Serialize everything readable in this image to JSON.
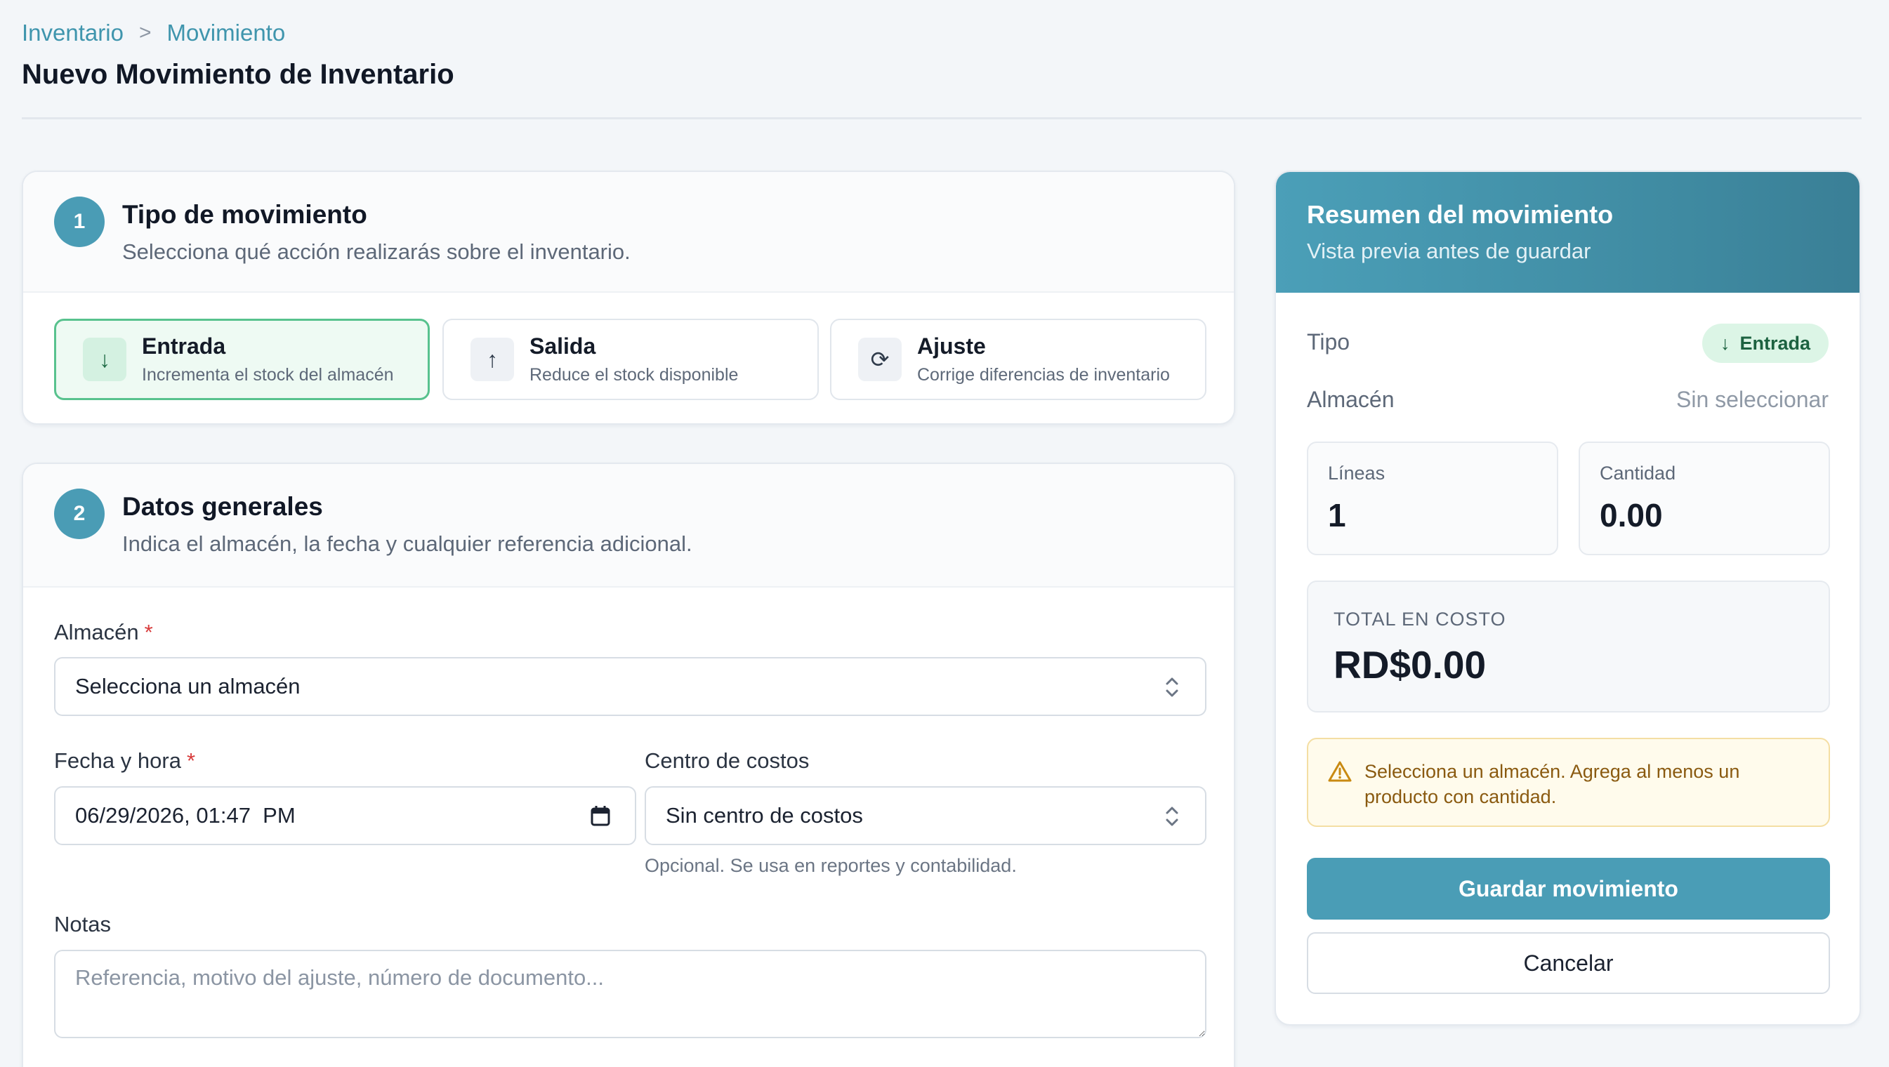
{
  "breadcrumb": {
    "items": [
      "Inventario",
      "Movimiento"
    ],
    "separator": ">"
  },
  "page": {
    "title": "Nuevo Movimiento de Inventario"
  },
  "section1": {
    "step": "1",
    "title": "Tipo de movimiento",
    "subtitle": "Selecciona qué acción realizarás sobre el inventario.",
    "options": [
      {
        "name": "Entrada",
        "description": "Incrementa el stock del almacén",
        "icon": "arrow-down-icon",
        "glyph": "↓",
        "selected": true
      },
      {
        "name": "Salida",
        "description": "Reduce el stock disponible",
        "icon": "arrow-up-icon",
        "glyph": "↑",
        "selected": false
      },
      {
        "name": "Ajuste",
        "description": "Corrige diferencias de inventario",
        "icon": "refresh-icon",
        "glyph": "⟳",
        "selected": false
      }
    ]
  },
  "section2": {
    "step": "2",
    "title": "Datos generales",
    "subtitle": "Indica el almacén, la fecha y cualquier referencia adicional.",
    "warehouse": {
      "label": "Almacén",
      "required_mark": "*",
      "value": "Selecciona un almacén"
    },
    "datetime": {
      "label": "Fecha y hora",
      "required_mark": "*",
      "value": "06/29/2026, 01:47  PM"
    },
    "cost_center": {
      "label": "Centro de costos",
      "value": "Sin centro de costos",
      "hint": "Opcional. Se usa en reportes y contabilidad."
    },
    "notes": {
      "label": "Notas",
      "placeholder": "Referencia, motivo del ajuste, número de documento..."
    }
  },
  "summary": {
    "title": "Resumen del movimiento",
    "subtitle": "Vista previa antes de guardar",
    "type_label": "Tipo",
    "type_value": "Entrada",
    "type_glyph": "↓",
    "warehouse_label": "Almacén",
    "warehouse_value": "Sin seleccionar",
    "lines_label": "Líneas",
    "lines_value": "1",
    "quantity_label": "Cantidad",
    "quantity_value": "0.00",
    "total_label": "TOTAL EN COSTO",
    "total_value": "RD$0.00",
    "warning": "Selecciona un almacén. Agrega al menos un producto con cantidad.",
    "save_label": "Guardar movimiento",
    "cancel_label": "Cancelar"
  },
  "colors": {
    "accent": "#4a9db6",
    "selected_border": "#58c28e",
    "warning_text": "#8a5a10",
    "required": "#d83b3b"
  }
}
